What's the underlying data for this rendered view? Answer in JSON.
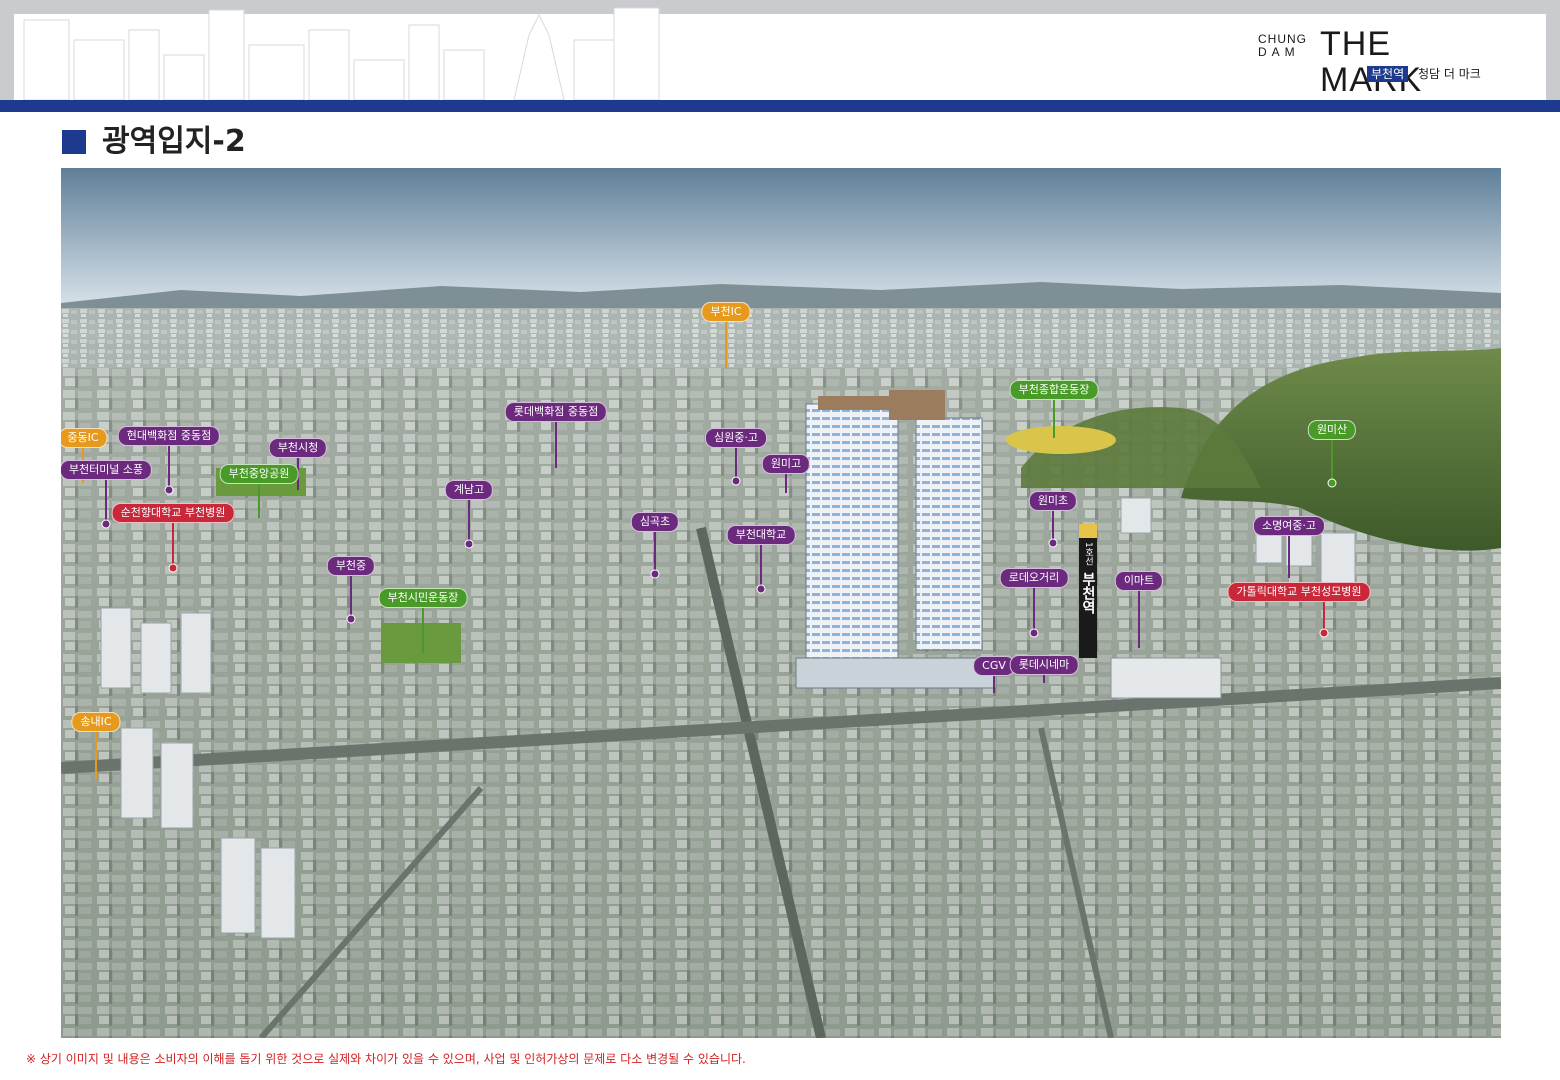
{
  "header": {
    "brand_line1": "CHUNG",
    "brand_line2": "DAM",
    "brand_main": "THE MARK",
    "brand_badge": "부천역",
    "brand_sub": "청담 더 마크"
  },
  "section": {
    "title": "광역입지-2"
  },
  "landmarks": [
    {
      "label": "부천IC",
      "color": "orange"
    },
    {
      "label": "중동IC",
      "color": "orange"
    },
    {
      "label": "현대백화점 중동점",
      "color": "purple"
    },
    {
      "label": "부천시청",
      "color": "purple"
    },
    {
      "label": "롯데백화점 중동점",
      "color": "purple"
    },
    {
      "label": "부천터미널 소풍",
      "color": "purple"
    },
    {
      "label": "부천중앙공원",
      "color": "green"
    },
    {
      "label": "순천향대학교 부천병원",
      "color": "red"
    },
    {
      "label": "계남고",
      "color": "purple"
    },
    {
      "label": "심곡초",
      "color": "purple"
    },
    {
      "label": "심원중·고",
      "color": "purple"
    },
    {
      "label": "원미고",
      "color": "purple"
    },
    {
      "label": "부천대학교",
      "color": "purple"
    },
    {
      "label": "부천중",
      "color": "purple"
    },
    {
      "label": "부천시민운동장",
      "color": "green"
    },
    {
      "label": "송내IC",
      "color": "orange"
    },
    {
      "label": "부천종합운동장",
      "color": "green"
    },
    {
      "label": "원미산",
      "color": "green"
    },
    {
      "label": "원미초",
      "color": "purple"
    },
    {
      "label": "소명여중·고",
      "color": "purple"
    },
    {
      "label": "로데오거리",
      "color": "purple"
    },
    {
      "label": "이마트",
      "color": "purple"
    },
    {
      "label": "가톨릭대학교 부천성모병원",
      "color": "red"
    },
    {
      "label": "CGV",
      "color": "purple"
    },
    {
      "label": "롯데시네마",
      "color": "purple"
    }
  ],
  "station_pillar": {
    "line_label": "1호선",
    "name": "부천역"
  },
  "disclaimer": "※ 상기 이미지 및 내용은 소비자의 이해를 돕기 위한 것으로 실제와 차이가 있을 수 있으며, 사업 및 인허가상의 문제로 다소 변경될 수 있습니다.",
  "colors": {
    "primary_blue": "#1d3a8f",
    "purple_tag": "#6b2a7e",
    "green_tag": "#4a9a2a",
    "orange_tag": "#e59a1e",
    "red_tag": "#c8283a",
    "disclaimer_red": "#d41e1e"
  }
}
